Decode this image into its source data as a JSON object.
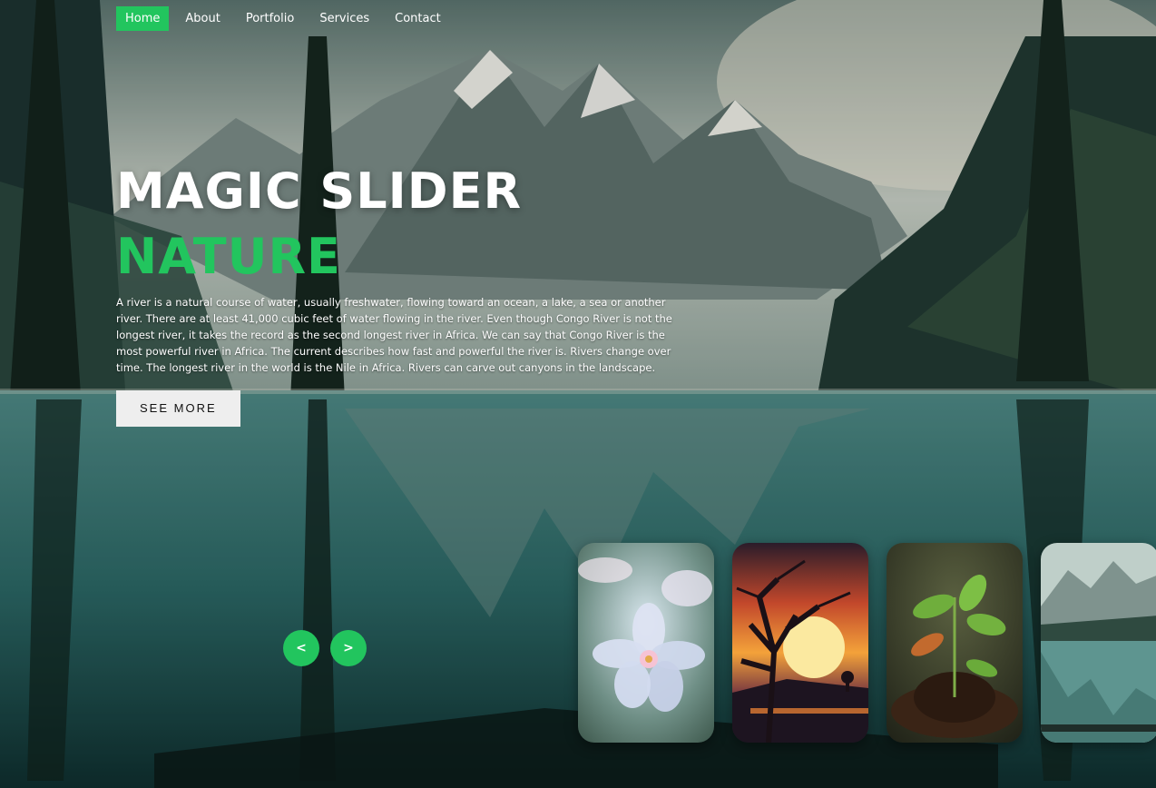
{
  "nav": {
    "items": [
      {
        "label": "Home",
        "active": true
      },
      {
        "label": "About",
        "active": false
      },
      {
        "label": "Portfolio",
        "active": false
      },
      {
        "label": "Services",
        "active": false
      },
      {
        "label": "Contact",
        "active": false
      }
    ]
  },
  "hero": {
    "title": "MAGIC SLIDER",
    "subtitle": "NATURE",
    "description": "A river is a natural course of water, usually freshwater, flowing toward an ocean, a lake, a sea or another river. There are at least 41,000 cubic feet of water flowing in the river. Even though Congo River is not the longest river, it takes the record as the second longest river in Africa. We can say that Congo River is the most powerful river in Africa. The current describes how fast and powerful the river is. Rivers change over time. The longest river in the world is the Nile in Africa. Rivers can carve out canyons in the landscape.",
    "button_label": "SEE MORE"
  },
  "controls": {
    "prev": "<",
    "next": ">"
  },
  "thumbnails": [
    {
      "name": "flower",
      "icon": "flower-thumbnail"
    },
    {
      "name": "sunset",
      "icon": "sunset-tree-thumbnail"
    },
    {
      "name": "sprout",
      "icon": "sprout-thumbnail"
    },
    {
      "name": "lake",
      "icon": "mountain-lake-thumbnail"
    }
  ],
  "colors": {
    "accent": "#22c55e",
    "button_bg": "#eeeeee"
  }
}
